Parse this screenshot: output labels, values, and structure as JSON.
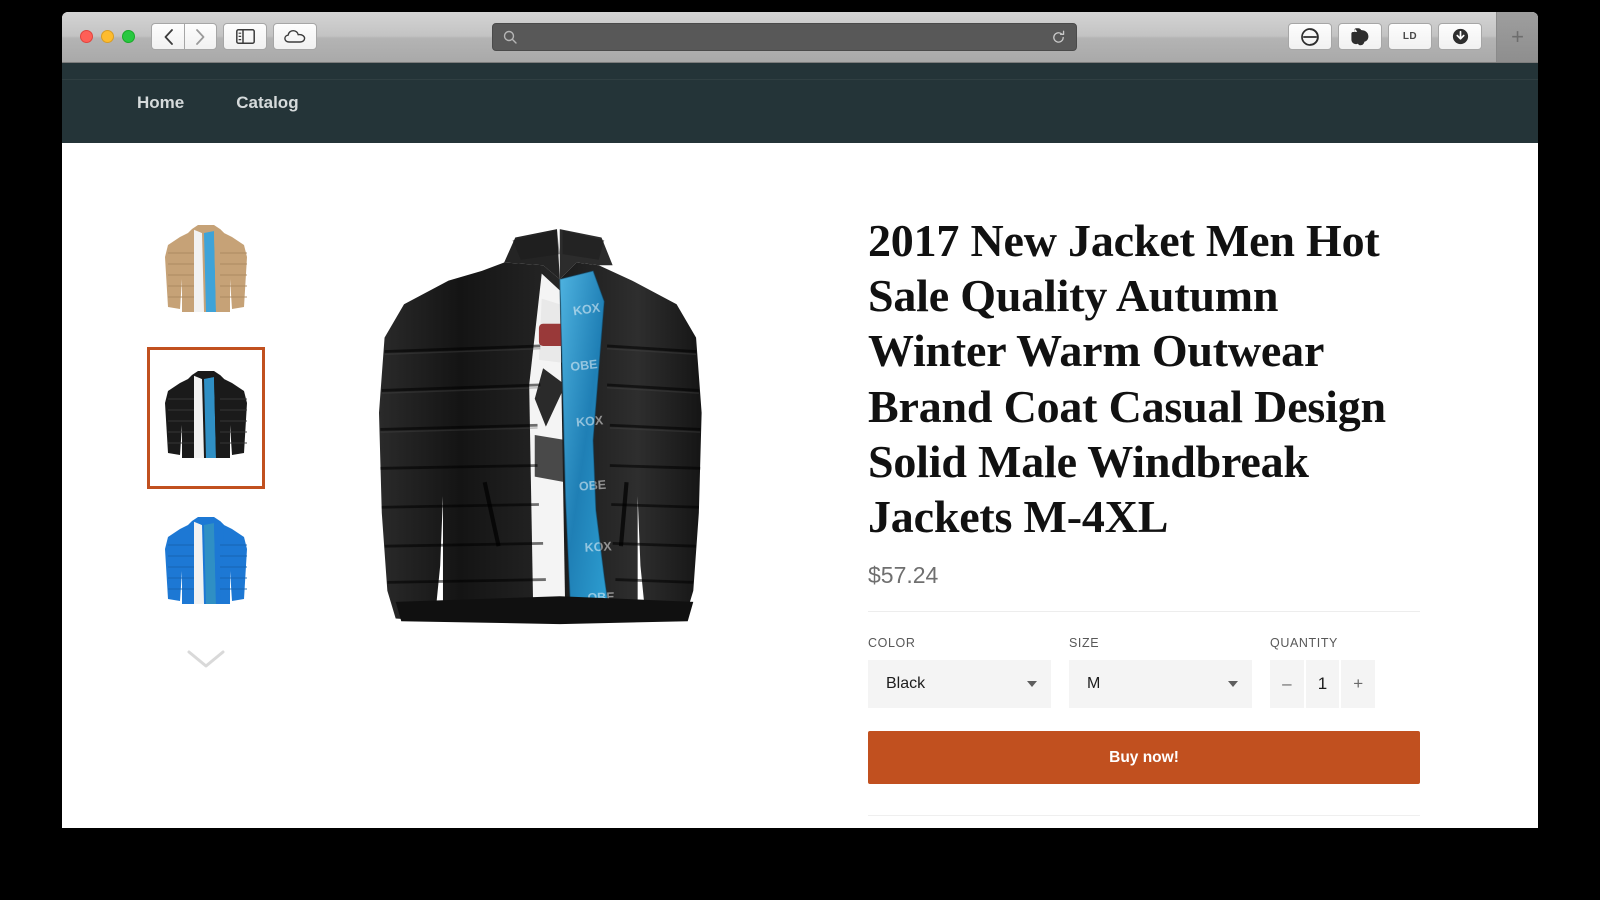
{
  "browser": {
    "traffic_lights": [
      "close",
      "minimize",
      "zoom"
    ],
    "back_label": "Back",
    "forward_label": "Forward",
    "sidebar_label": "Show Sidebar",
    "cloud_label": "iCloud Tabs",
    "address_value": "",
    "address_placeholder": "",
    "reload_label": "Reload",
    "new_tab_label": "+",
    "extensions": [
      {
        "name": "adblock-extension-icon",
        "label": ""
      },
      {
        "name": "evernote-extension-icon",
        "label": ""
      },
      {
        "name": "ld-extension-icon",
        "label": "LD"
      },
      {
        "name": "download-extension-icon",
        "label": ""
      }
    ]
  },
  "site": {
    "nav": [
      {
        "label": "Home"
      },
      {
        "label": "Catalog"
      }
    ],
    "nav_bg": "#243438"
  },
  "gallery": {
    "thumbnails": [
      {
        "alt": "Khaki jacket",
        "color": "#c6a277",
        "selected": false
      },
      {
        "alt": "Black jacket",
        "color": "#1a1a1a",
        "selected": true
      },
      {
        "alt": "Blue jacket",
        "color": "#1d78d4",
        "selected": false
      }
    ],
    "scroll_down_icon": "chevron-down-icon",
    "main_image_alt": "Black puffer jacket, open, with blue printed lining"
  },
  "product": {
    "title": "2017 New Jacket Men Hot Sale Quality Autumn Winter Warm Outwear Brand Coat Casual Design Solid Male Windbreak Jackets M-4XL",
    "price": "$57.24",
    "color_label": "COLOR",
    "color_value": "Black",
    "color_options": [
      "Black"
    ],
    "size_label": "SIZE",
    "size_value": "M",
    "size_options": [
      "M"
    ],
    "quantity_label": "QUANTITY",
    "quantity_value": "1",
    "decrement_label": "–",
    "increment_label": "+",
    "buy_label": "Buy now!",
    "accent_color": "#c1501f"
  }
}
